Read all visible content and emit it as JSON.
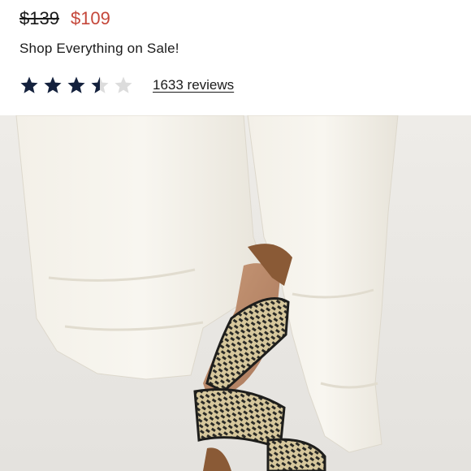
{
  "product": {
    "price_original": "$139",
    "price_sale": "$109",
    "promo_text": "Shop Everything on Sale!",
    "rating": 3.5,
    "rating_max": 5,
    "reviews_text": "1633 reviews"
  },
  "colors": {
    "sale_price": "#c5473a",
    "star_filled": "#14213d",
    "star_empty": "#dcdcdc",
    "text": "#1a1a1a"
  },
  "image": {
    "icon": "product-photo-sandal"
  }
}
